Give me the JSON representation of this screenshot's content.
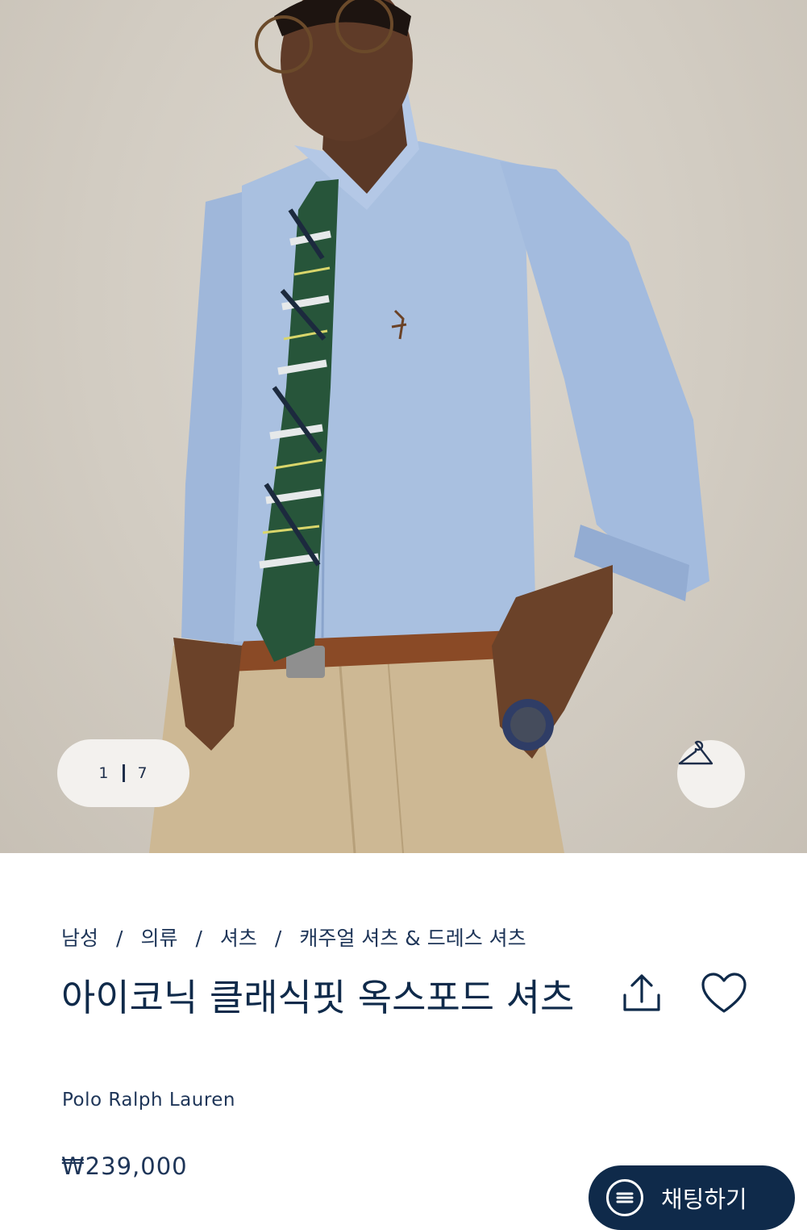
{
  "gallery": {
    "current_index": "1",
    "total": "7",
    "image_alt": "Model wearing light blue oxford shirt with plaid tie and khaki trousers"
  },
  "breadcrumb": {
    "items": [
      "남성",
      "의류",
      "셔츠",
      "캐주얼 셔츠 & 드레스 셔츠"
    ],
    "separator": "/"
  },
  "product": {
    "title": "아이코닉 클래식핏 옥스포드 셔츠",
    "brand": "Polo Ralph Lauren",
    "price": "₩239,000"
  },
  "icons": {
    "hanger": "hanger-icon",
    "share": "share-icon",
    "wishlist": "heart-icon",
    "chat": "chat-bubble-icon"
  },
  "chat": {
    "label": "채팅하기"
  },
  "colors": {
    "navy": "#0f2a4a",
    "pill_bg": "#f3f1ee",
    "backdrop": "#d2ccc2",
    "shirt": "#a9c0e0",
    "trousers": "#cdb894"
  }
}
